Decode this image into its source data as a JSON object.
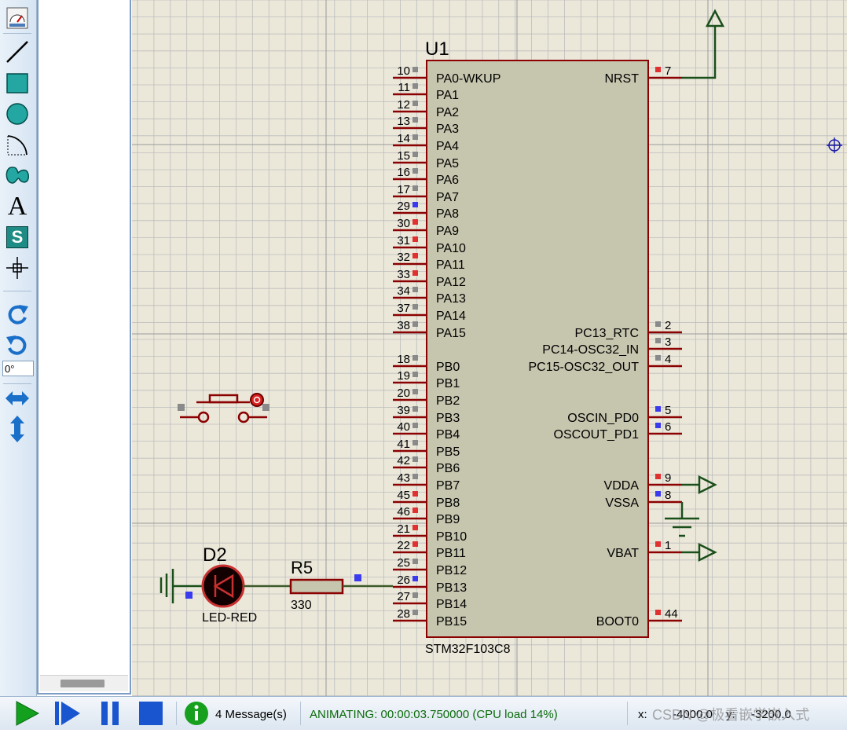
{
  "toolbar": {
    "tools": [
      {
        "name": "gauge-icon"
      },
      {
        "name": "line-icon"
      },
      {
        "name": "box-icon"
      },
      {
        "name": "circle-icon"
      },
      {
        "name": "arc-icon"
      },
      {
        "name": "path-icon"
      },
      {
        "name": "text-icon",
        "glyph": "A"
      },
      {
        "name": "symbol-icon",
        "glyph": "S"
      },
      {
        "name": "marker-icon"
      },
      {
        "name": "rotate-cw-icon"
      },
      {
        "name": "rotate-ccw-icon"
      },
      {
        "name": "mirror-horizontal-icon"
      },
      {
        "name": "mirror-vertical-icon"
      }
    ],
    "rotation_angle": "0°",
    "accent": "#1a6fc9"
  },
  "status": {
    "messages_label": "4 Message(s)",
    "animation_status": "ANIMATING: 00:00:03.750000 (CPU load 14%)",
    "coords_label": "x:",
    "x_value": "-4000.0",
    "y_label": "y:",
    "y_value": "-3200.0",
    "watermark": "CSDN @极看嵌学嵌入式"
  },
  "schematic": {
    "background": "#ebe8da",
    "grid_color": "#bcbcbc",
    "wire_color": "#8b0000",
    "power_color": "#1a4f1a",
    "body_fill": "#c6c5ae",
    "pin_state_colors": {
      "red": "#e03030",
      "blue": "#3a3aee",
      "gray": "#8a8a8a"
    },
    "chip": {
      "ref": "U1",
      "value": "STM32F103C8",
      "left_pins": [
        {
          "num": "10",
          "name": "PA0-WKUP",
          "state": "gray"
        },
        {
          "num": "11",
          "name": "PA1",
          "state": "gray"
        },
        {
          "num": "12",
          "name": "PA2",
          "state": "gray"
        },
        {
          "num": "13",
          "name": "PA3",
          "state": "gray"
        },
        {
          "num": "14",
          "name": "PA4",
          "state": "gray"
        },
        {
          "num": "15",
          "name": "PA5",
          "state": "gray"
        },
        {
          "num": "16",
          "name": "PA6",
          "state": "gray"
        },
        {
          "num": "17",
          "name": "PA7",
          "state": "gray"
        },
        {
          "num": "29",
          "name": "PA8",
          "state": "blue"
        },
        {
          "num": "30",
          "name": "PA9",
          "state": "red"
        },
        {
          "num": "31",
          "name": "PA10",
          "state": "red"
        },
        {
          "num": "32",
          "name": "PA11",
          "state": "red"
        },
        {
          "num": "33",
          "name": "PA12",
          "state": "red"
        },
        {
          "num": "34",
          "name": "PA13",
          "state": "gray"
        },
        {
          "num": "37",
          "name": "PA14",
          "state": "gray"
        },
        {
          "num": "38",
          "name": "PA15",
          "state": "gray"
        },
        {
          "num": "18",
          "name": "PB0",
          "state": "gray"
        },
        {
          "num": "19",
          "name": "PB1",
          "state": "gray"
        },
        {
          "num": "20",
          "name": "PB2",
          "state": "gray"
        },
        {
          "num": "39",
          "name": "PB3",
          "state": "gray"
        },
        {
          "num": "40",
          "name": "PB4",
          "state": "gray"
        },
        {
          "num": "41",
          "name": "PB5",
          "state": "gray"
        },
        {
          "num": "42",
          "name": "PB6",
          "state": "gray"
        },
        {
          "num": "43",
          "name": "PB7",
          "state": "gray"
        },
        {
          "num": "45",
          "name": "PB8",
          "state": "red"
        },
        {
          "num": "46",
          "name": "PB9",
          "state": "red"
        },
        {
          "num": "21",
          "name": "PB10",
          "state": "red"
        },
        {
          "num": "22",
          "name": "PB11",
          "state": "red"
        },
        {
          "num": "25",
          "name": "PB12",
          "state": "gray"
        },
        {
          "num": "26",
          "name": "PB13",
          "state": "blue"
        },
        {
          "num": "27",
          "name": "PB14",
          "state": "gray"
        },
        {
          "num": "28",
          "name": "PB15",
          "state": "gray"
        }
      ],
      "right_pins": [
        {
          "num": "7",
          "name": "NRST",
          "state": "red"
        },
        {
          "num": "2",
          "name": "PC13_RTC",
          "state": "gray"
        },
        {
          "num": "3",
          "name": "PC14-OSC32_IN",
          "state": "gray"
        },
        {
          "num": "4",
          "name": "PC15-OSC32_OUT",
          "state": "gray"
        },
        {
          "num": "5",
          "name": "OSCIN_PD0",
          "state": "blue"
        },
        {
          "num": "6",
          "name": "OSCOUT_PD1",
          "state": "blue"
        },
        {
          "num": "9",
          "name": "VDDA",
          "state": "red"
        },
        {
          "num": "8",
          "name": "VSSA",
          "state": "blue"
        },
        {
          "num": "1",
          "name": "VBAT",
          "state": "red"
        },
        {
          "num": "44",
          "name": "BOOT0",
          "state": "red"
        }
      ]
    },
    "led": {
      "ref": "D2",
      "value": "LED-RED"
    },
    "resistor": {
      "ref": "R5",
      "value": "330"
    }
  }
}
